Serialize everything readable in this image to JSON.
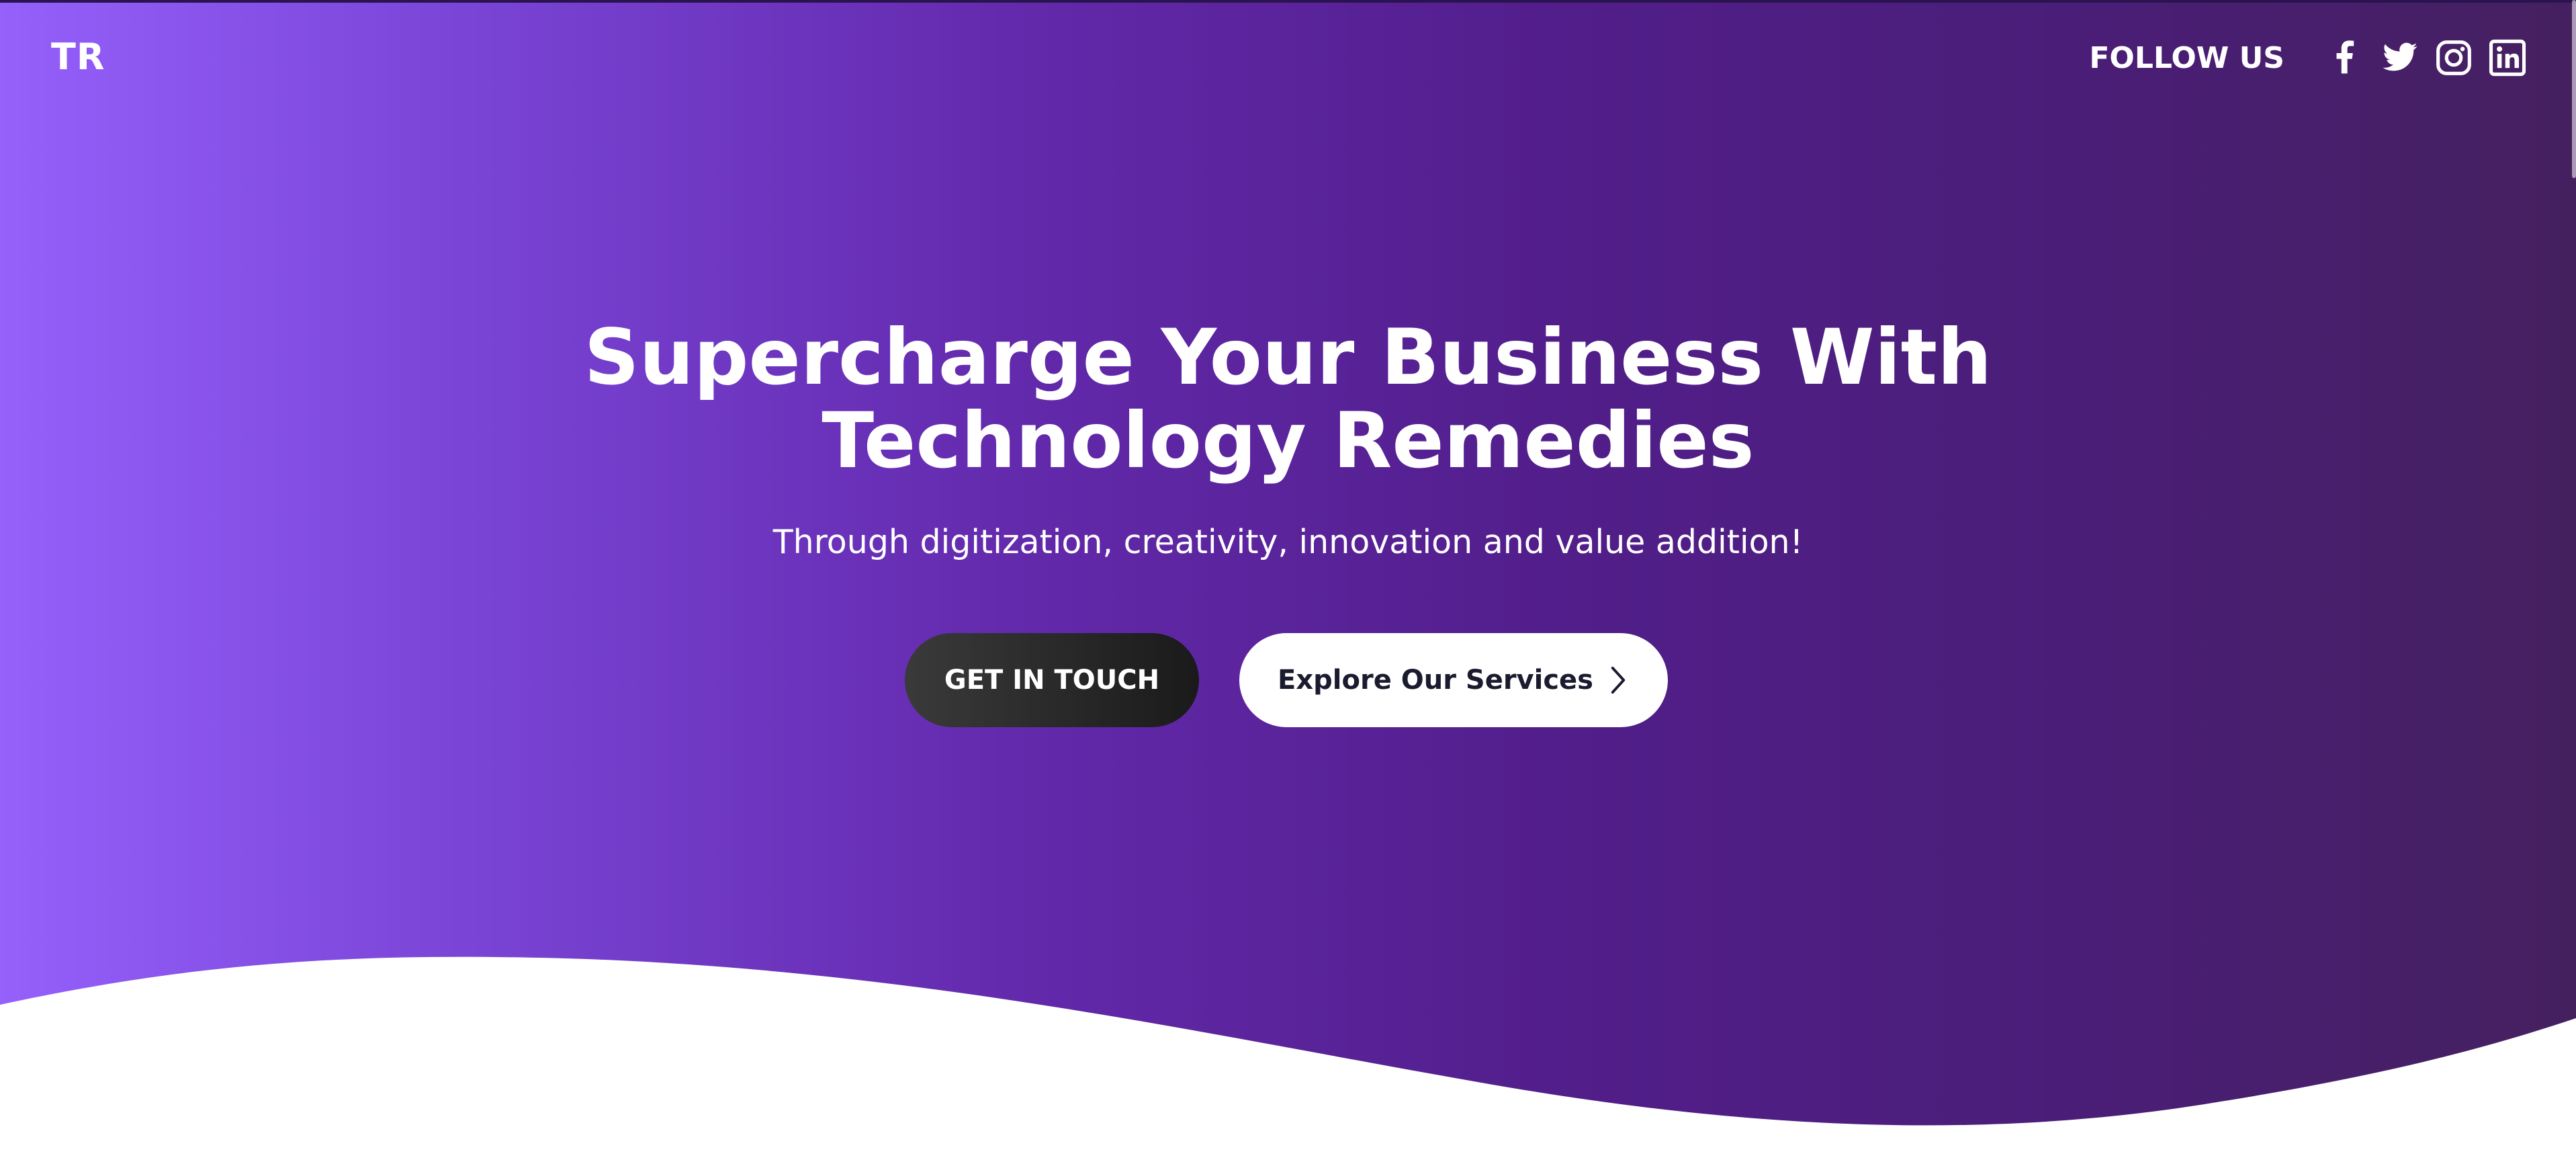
{
  "brand": {
    "logo": "TR"
  },
  "header": {
    "follow_label": "FOLLOW US",
    "social": [
      {
        "icon": "facebook-icon"
      },
      {
        "icon": "twitter-icon"
      },
      {
        "icon": "instagram-icon"
      },
      {
        "icon": "linkedin-icon"
      }
    ]
  },
  "hero": {
    "headline_line1": "Supercharge Your Business With",
    "headline_line2": "Technology Remedies",
    "subtitle": "Through digitization, creativity, innovation and value addition!",
    "primary_button": "GET IN TOUCH",
    "secondary_button": "Explore Our Services",
    "secondary_icon": "chevron-right-icon"
  },
  "colors": {
    "gradient_start": "#9560fb",
    "gradient_end": "#45205f",
    "primary_button_bg": "#222222",
    "secondary_button_bg": "#ffffff",
    "text": "#ffffff"
  }
}
